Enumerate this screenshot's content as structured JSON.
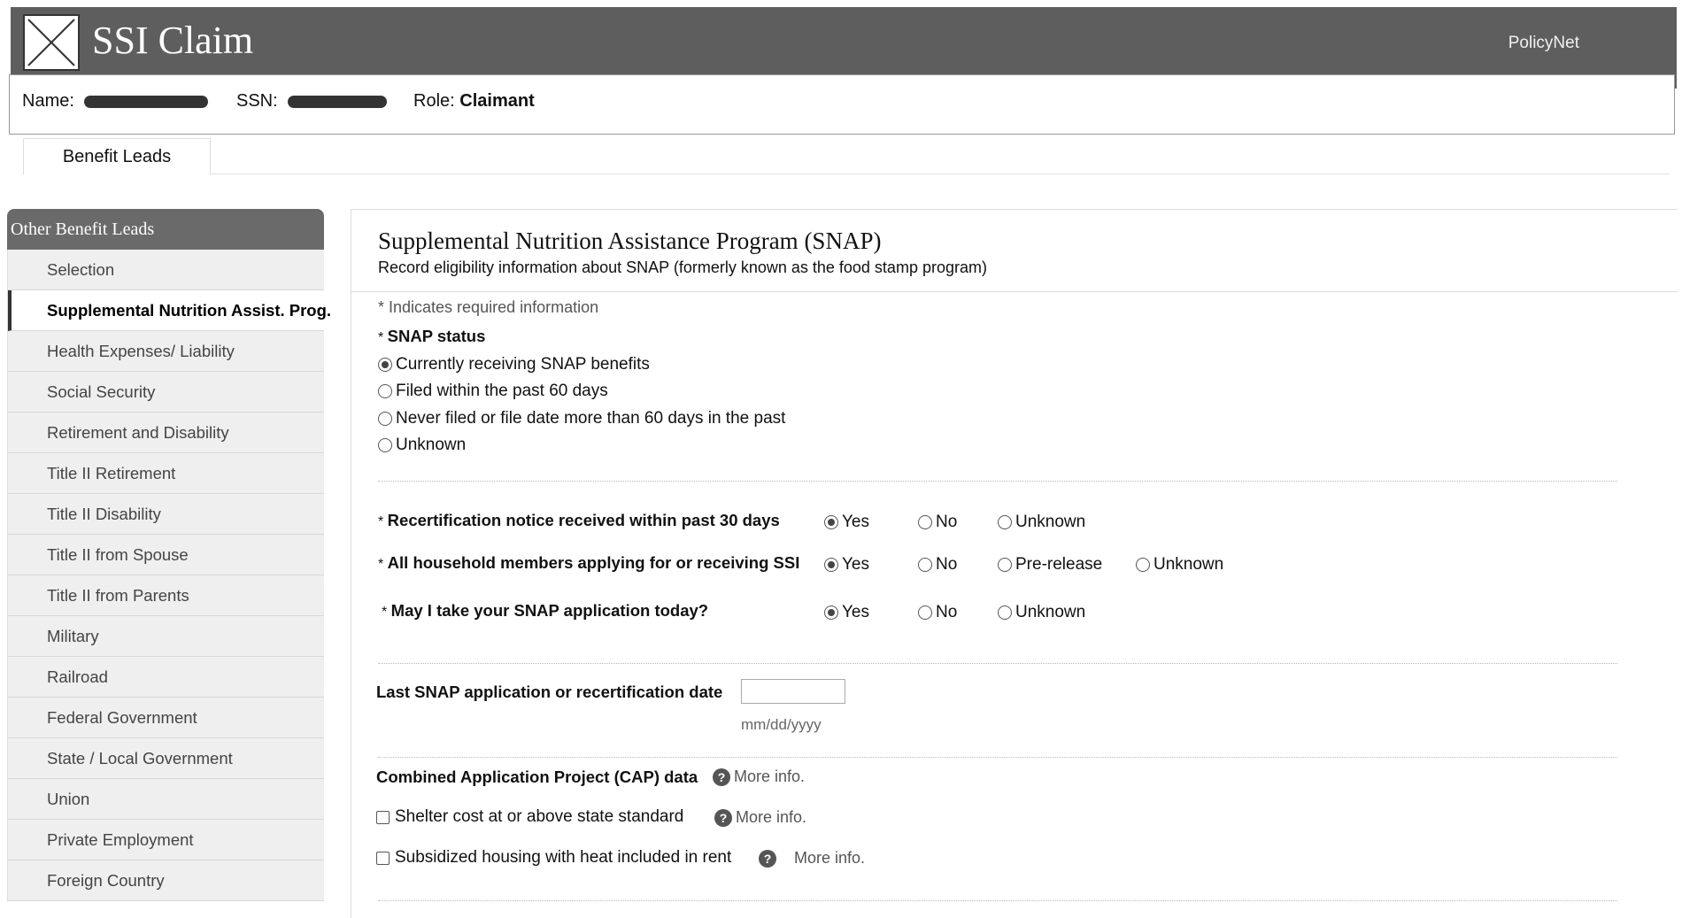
{
  "header": {
    "app_title": "SSI Claim",
    "policynet": "PolicyNet",
    "name_label": "Name:",
    "ssn_label": "SSN:",
    "role_label": "Role:",
    "role_value": "Claimant"
  },
  "tabs": {
    "benefit_leads": "Benefit Leads"
  },
  "sidebar": {
    "title": "Other Benefit Leads",
    "items": [
      {
        "label": "Selection"
      },
      {
        "label": "Supplemental Nutrition Assist. Prog."
      },
      {
        "label": "Health Expenses/ Liability"
      },
      {
        "label": "Social Security"
      },
      {
        "label": "Retirement and Disability"
      },
      {
        "label": "Title II Retirement"
      },
      {
        "label": "Title II Disability"
      },
      {
        "label": "Title II from Spouse"
      },
      {
        "label": "Title II from Parents"
      },
      {
        "label": "Military"
      },
      {
        "label": "Railroad"
      },
      {
        "label": "Federal Government"
      },
      {
        "label": "State / Local Government"
      },
      {
        "label": "Union"
      },
      {
        "label": "Private Employment"
      },
      {
        "label": "Foreign Country"
      }
    ]
  },
  "main": {
    "title": "Supplemental Nutrition Assistance Program (SNAP)",
    "subtitle": "Record eligibility information about SNAP (formerly known as the food stamp program)",
    "required_note": "* Indicates required information",
    "snap_status": {
      "label": "SNAP status",
      "options": [
        "Currently receiving SNAP benefits",
        "Filed within the past 60 days",
        "Never filed or file date more than 60 days in the past",
        "Unknown"
      ],
      "selected": "Currently receiving SNAP benefits"
    },
    "recert": {
      "label": "Recertification notice received within past 30 days",
      "options": [
        "Yes",
        "No",
        "Unknown"
      ],
      "selected": "Yes"
    },
    "household": {
      "label": "All household members applying for or receiving SSI",
      "options": [
        "Yes",
        "No",
        "Pre-release",
        "Unknown"
      ],
      "selected": "Yes"
    },
    "take_app": {
      "label": "May I take your SNAP application today?",
      "options": [
        "Yes",
        "No",
        "Unknown"
      ],
      "selected": "Yes"
    },
    "last_date": {
      "label": "Last SNAP application or recertification date",
      "value": "",
      "hint": "mm/dd/yyyy"
    },
    "cap": {
      "label": "Combined Application Project (CAP) data",
      "more_info": "More info.",
      "items": [
        {
          "label": "Shelter cost at or above state standard",
          "checked": false,
          "more_info": "More info."
        },
        {
          "label": "Subsidized housing with heat included in rent",
          "checked": false,
          "more_info": "More info."
        }
      ]
    }
  }
}
